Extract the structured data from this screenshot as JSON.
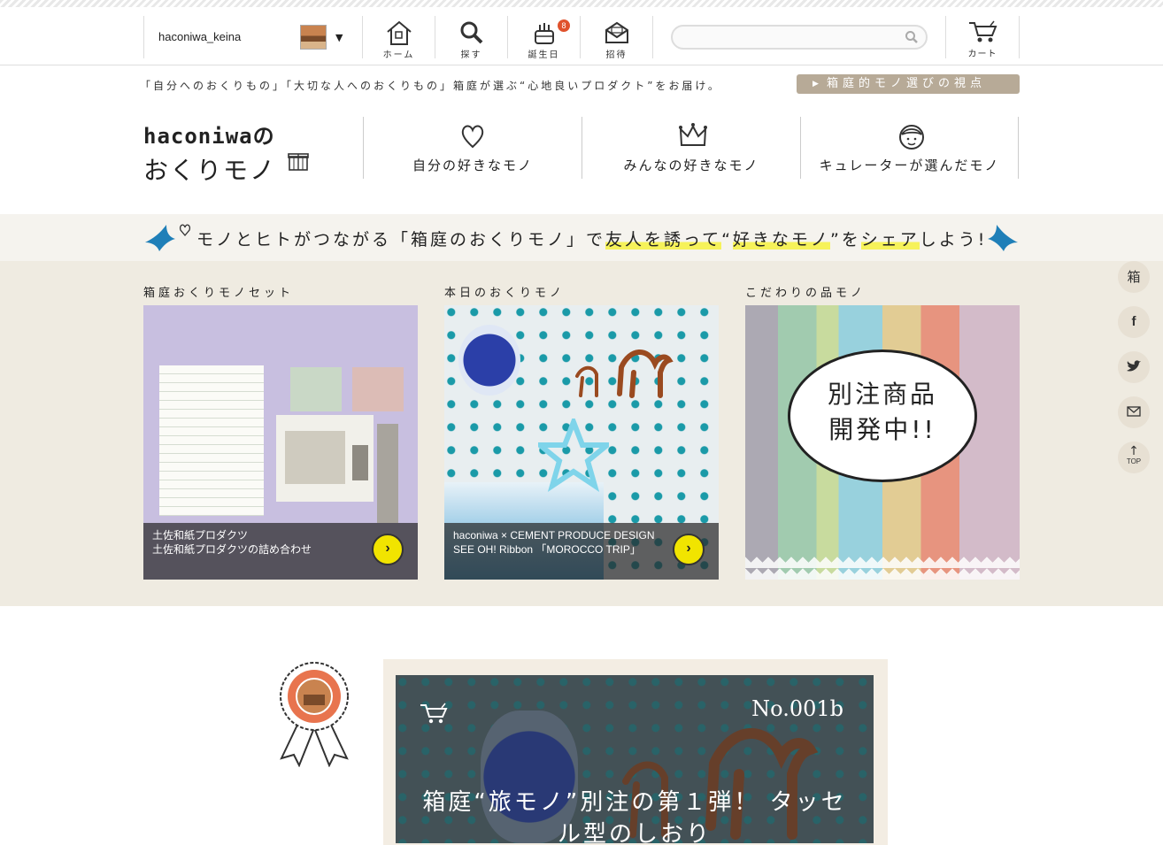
{
  "header": {
    "username": "haconiwa_keina",
    "nav": [
      {
        "label": "ホーム",
        "icon": "home-icon"
      },
      {
        "label": "探す",
        "icon": "search-magnifier-icon"
      },
      {
        "label": "誕生日",
        "icon": "birthday-cake-icon",
        "badge": "8"
      },
      {
        "label": "招待",
        "icon": "invite-envelope-icon"
      }
    ],
    "search_placeholder": "",
    "cart_label": "カート"
  },
  "tagline": "「自分へのおくりもの」「大切な人へのおくりもの」箱庭が選ぶ“心地良いプロダクト”をお届け。",
  "viewpoint_button": "箱庭的モノ選びの視点",
  "logo": {
    "line1": "haconiwaの",
    "line2": "おくりモノ"
  },
  "categories": [
    {
      "label": "自分の好きなモノ",
      "icon": "heart-icon"
    },
    {
      "label": "みんなの好きなモノ",
      "icon": "crown-icon"
    },
    {
      "label": "キュレーターが選んだモノ",
      "icon": "curator-face-icon"
    }
  ],
  "share_banner": {
    "pre": "モノとヒトがつながる「箱庭のおくりモノ」で",
    "hl1": "友人を誘って",
    "mid": "“",
    "hl2": "好きなモノ",
    "mid2": "”を",
    "hl3": "シェア",
    "post": "しよう!"
  },
  "features": [
    {
      "title": "箱庭おくりモノセット",
      "caption1": "土佐和紙プロダクツ",
      "caption2": "土佐和紙プロダクツの詰め合わせ"
    },
    {
      "title": "本日のおくりモノ",
      "caption1": "haconiwa × CEMENT PRODUCE DESIGN",
      "caption2": "SEE OH! Ribbon 「MOROCCO TRIP」"
    },
    {
      "title": "こだわりの品モノ",
      "bubble": "別注商品\n開発中!!",
      "bubble_l1": "別注商品",
      "bubble_l2": "開発中!!"
    }
  ],
  "sidebar": [
    {
      "label": "箱"
    },
    {
      "label": "f"
    },
    {
      "label": "twitter",
      "icon": "twitter-bird-icon"
    },
    {
      "label": "mail",
      "icon": "mail-icon"
    },
    {
      "label": "TOP"
    }
  ],
  "hero": {
    "number": "No.001b",
    "title": "箱庭“旅モノ”別注の第１弾！ タッセル型のしおり"
  }
}
